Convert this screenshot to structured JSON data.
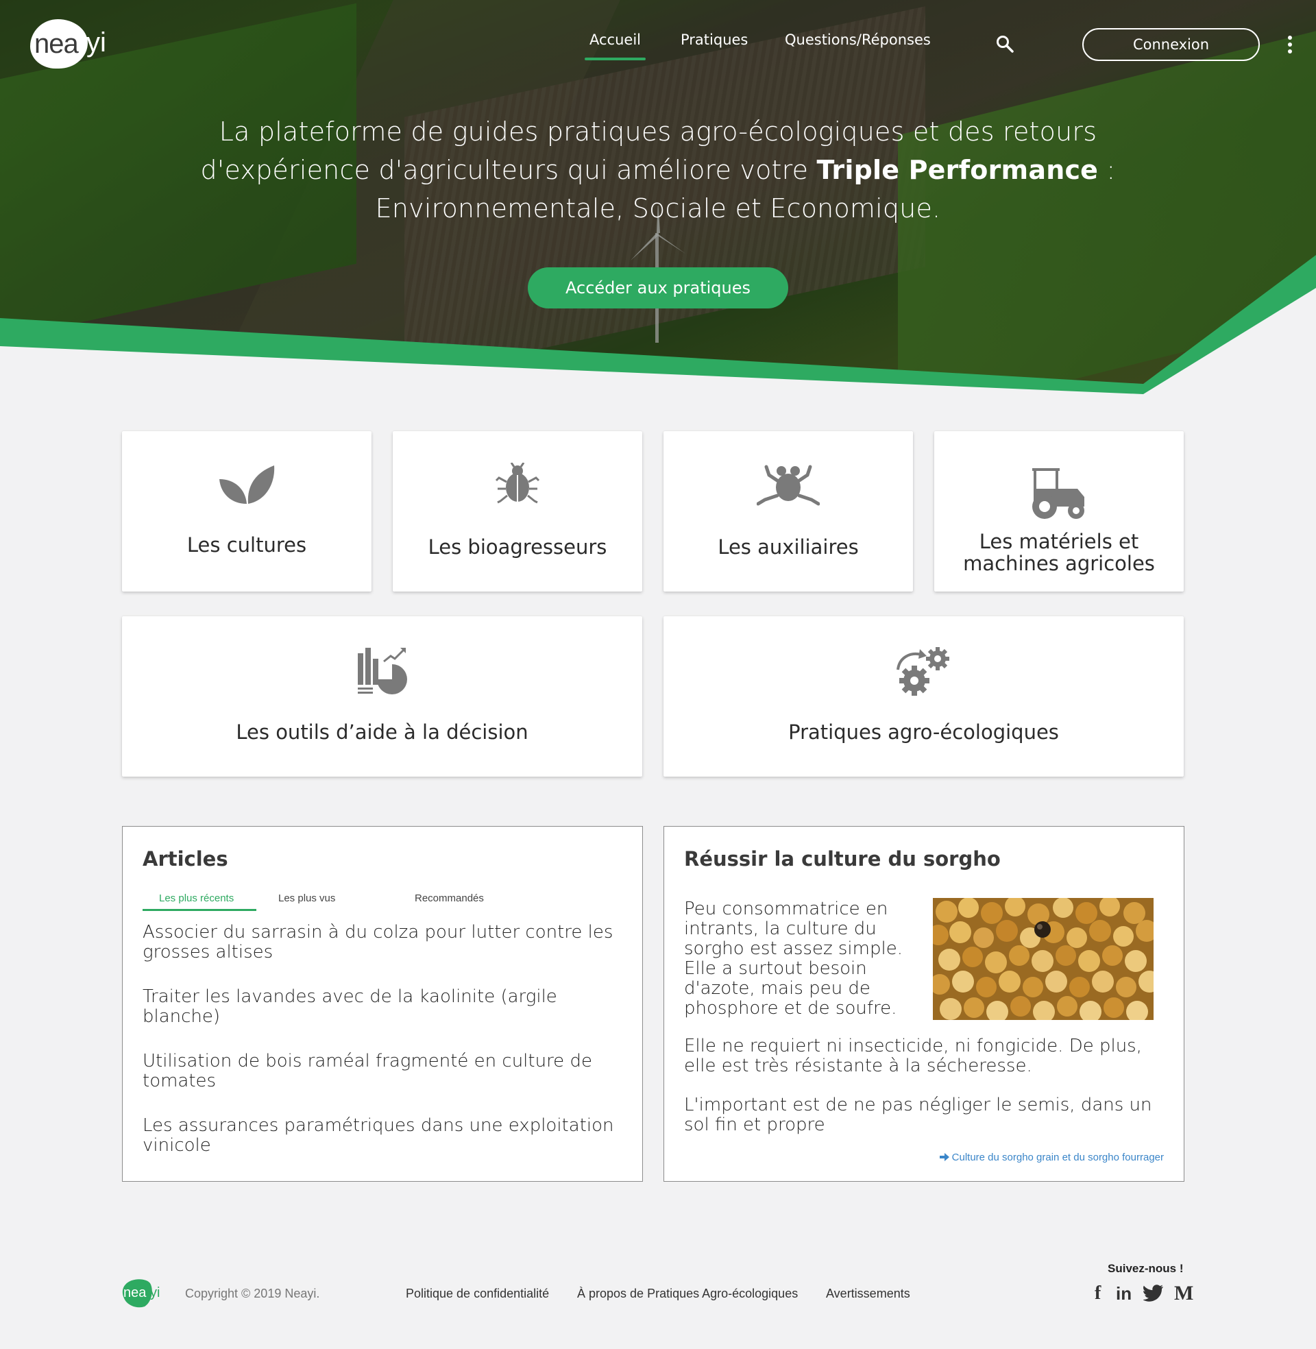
{
  "colors": {
    "accent": "#2eaa61",
    "link": "#3b86c9",
    "icon_grey": "#7a7a7a"
  },
  "header": {
    "logo_text_a": "nea",
    "logo_text_b": "yi",
    "nav": [
      {
        "label": "Accueil",
        "active": true
      },
      {
        "label": "Pratiques",
        "active": false
      },
      {
        "label": "Questions/Réponses",
        "active": false
      }
    ],
    "search_icon": "search-icon",
    "login_label": "Connexion",
    "menu_icon": "kebab-icon"
  },
  "hero": {
    "line1": "La plateforme de guides pratiques agro-écologiques et des retours",
    "line2_pre": "d'expérience d'agriculteurs qui améliore votre ",
    "line2_bold": "Triple Performance",
    "line2_post": " :",
    "line3": "Environnementale, Sociale et Economique.",
    "cta_label": "Accéder aux pratiques"
  },
  "categories": [
    {
      "label": "Les cultures",
      "icon": "leaves-icon"
    },
    {
      "label": "Les bioagresseurs",
      "icon": "beetle-icon"
    },
    {
      "label": "Les auxiliaires",
      "icon": "frog-icon"
    },
    {
      "label_line1": "Les matériels et",
      "label_line2": "machines agricoles",
      "icon": "tractor-icon"
    },
    {
      "label": "Les outils d’aide à la décision",
      "icon": "chart-tools-icon"
    },
    {
      "label": "Pratiques agro-écologiques",
      "icon": "gears-icon"
    }
  ],
  "articles": {
    "title": "Articles",
    "tabs": [
      "Les plus récents",
      "Les plus vus",
      "Recommandés"
    ],
    "items": [
      "Associer du sarrasin à du colza pour lutter contre les grosses altises",
      "Traiter les lavandes avec de la kaolinite (argile blanche)",
      "Utilisation de bois raméal fragmenté en culture de tomates",
      "Les assurances paramétriques dans une exploitation vinicole"
    ]
  },
  "sorgho": {
    "title": "Réussir la culture du sorgho",
    "p1": "Peu consommatrice en intrants, la culture du sorgho est assez simple. Elle a surtout besoin d'azote, mais peu de phosphore et de soufre.",
    "p2": "Elle ne requiert ni insecticide, ni fongicide. De plus, elle est très résistante à la sécheresse.",
    "p3": "L'important est de ne pas négliger le semis, dans un sol fin et propre",
    "link": "Culture du sorgho grain et du sorgho fourrager"
  },
  "footer": {
    "copyright": "Copyright © 2019 Neayi.",
    "links": [
      "Politique de confidentialité",
      "À propos de Pratiques Agro-écologiques",
      "Avertissements"
    ],
    "follow": "Suivez-nous !",
    "social": [
      "f",
      "in",
      "M"
    ]
  }
}
